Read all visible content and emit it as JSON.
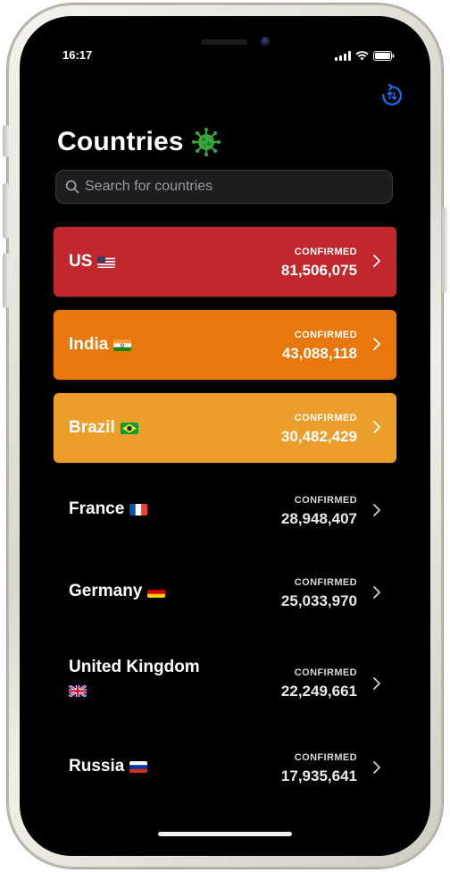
{
  "status_bar": {
    "time": "16:17"
  },
  "header": {
    "title": "Countries",
    "title_icon": "virus-icon",
    "refresh_icon": "refresh-icon"
  },
  "search": {
    "placeholder": "Search for countries",
    "value": ""
  },
  "countries": [
    {
      "name": "US",
      "flag": "us-flag-icon",
      "label": "CONFIRMED",
      "value": "81,506,075",
      "color": "#c0282c"
    },
    {
      "name": "India",
      "flag": "india-flag-icon",
      "label": "CONFIRMED",
      "value": "43,088,118",
      "color": "#e8780c"
    },
    {
      "name": "Brazil",
      "flag": "brazil-flag-icon",
      "label": "CONFIRMED",
      "value": "30,482,429",
      "color": "#ec9e2a"
    },
    {
      "name": "France",
      "flag": "france-flag-icon",
      "label": "CONFIRMED",
      "value": "28,948,407",
      "color": "#000000"
    },
    {
      "name": "Germany",
      "flag": "germany-flag-icon",
      "label": "CONFIRMED",
      "value": "25,033,970",
      "color": "#000000"
    },
    {
      "name": "United Kingdom",
      "flag": "uk-flag-icon",
      "label": "CONFIRMED",
      "value": "22,249,661",
      "color": "#000000"
    },
    {
      "name": "Russia",
      "flag": "russia-flag-icon",
      "label": "CONFIRMED",
      "value": "17,935,641",
      "color": "#000000"
    }
  ],
  "colors": {
    "accent": "#1b6ef5",
    "background": "#000000",
    "virus_green": "#3aa63a"
  }
}
